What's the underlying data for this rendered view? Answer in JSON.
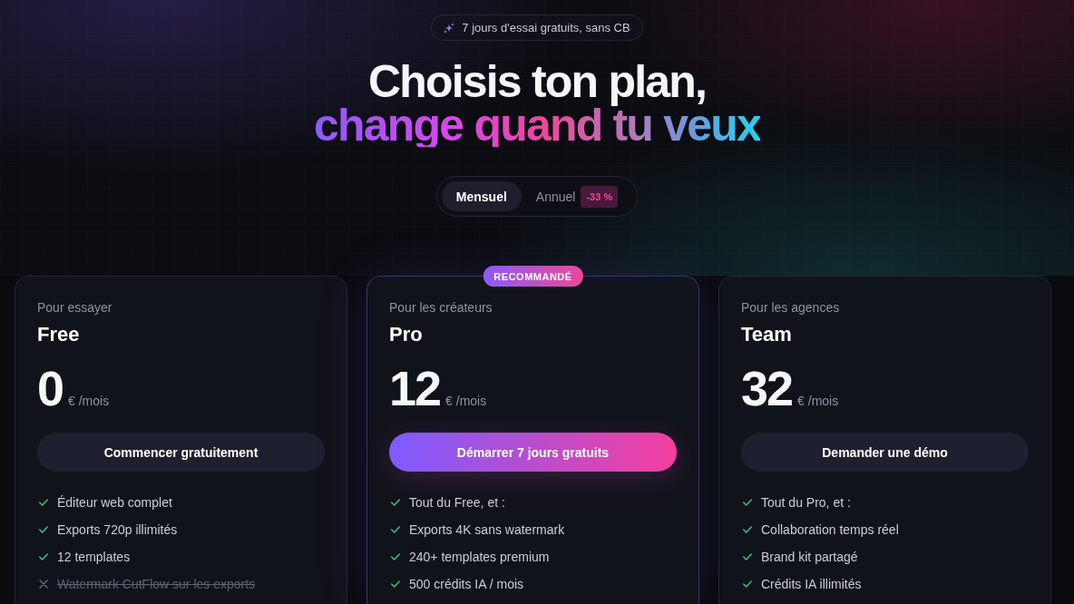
{
  "trial_badge": "7 jours d'essai gratuits, sans CB",
  "headline": {
    "title": "Choisis ton plan,",
    "accent": "change quand tu veux"
  },
  "billing": {
    "options": [
      {
        "label": "Mensuel",
        "selected": true
      },
      {
        "label": "Annuel",
        "selected": false,
        "discount": "-33 %"
      }
    ]
  },
  "plans": [
    {
      "audience": "Pour essayer",
      "name": "Free",
      "price": "0",
      "unit": "€ /mois",
      "cta": "Commencer gratuitement",
      "featured": false,
      "features": [
        {
          "text": "Éditeur web complet",
          "included": true
        },
        {
          "text": "Exports 720p illimités",
          "included": true
        },
        {
          "text": "12 templates",
          "included": true
        },
        {
          "text": "Watermark CutFlow sur les exports",
          "included": false
        }
      ]
    },
    {
      "audience": "Pour les créateurs",
      "name": "Pro",
      "badge": "RECOMMANDÉ",
      "price": "12",
      "unit": "€ /mois",
      "cta": "Démarrer 7 jours gratuits",
      "featured": true,
      "features": [
        {
          "text": "Tout du Free, et :",
          "included": true
        },
        {
          "text": "Exports 4K sans watermark",
          "included": true
        },
        {
          "text": "240+ templates premium",
          "included": true
        },
        {
          "text": "500 crédits IA / mois",
          "included": true
        }
      ]
    },
    {
      "audience": "Pour les agences",
      "name": "Team",
      "price": "32",
      "unit": "€ /mois",
      "cta": "Demander une démo",
      "featured": false,
      "features": [
        {
          "text": "Tout du Pro, et :",
          "included": true
        },
        {
          "text": "Collaboration temps réel",
          "included": true
        },
        {
          "text": "Brand kit partagé",
          "included": true
        },
        {
          "text": "Crédits IA illimités",
          "included": true
        }
      ]
    }
  ]
}
